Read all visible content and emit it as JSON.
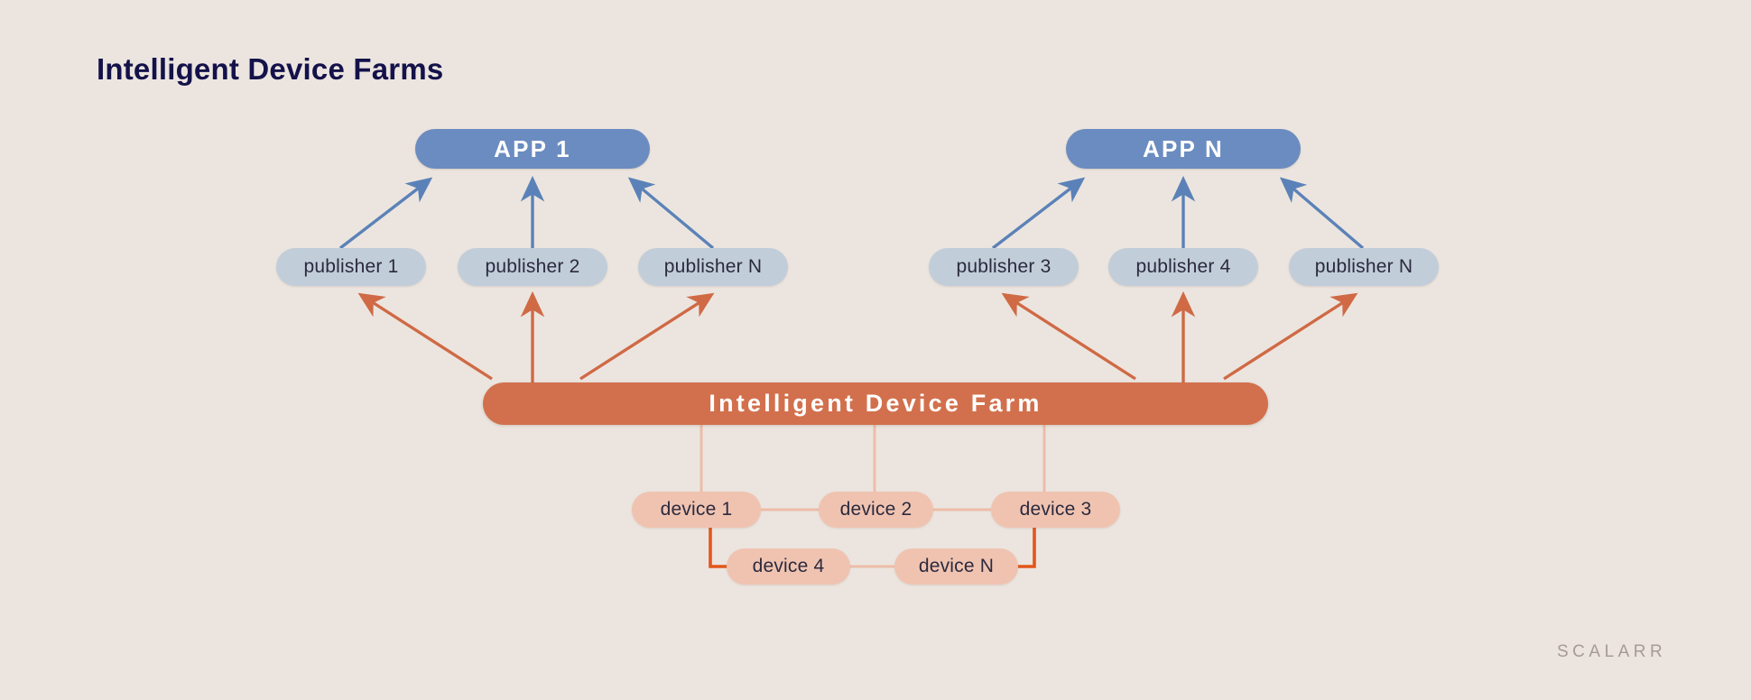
{
  "page": {
    "title": "Intelligent Device Farms",
    "watermark": "SCALARR",
    "background_color": "#ece5df",
    "title_color": "#14124a"
  },
  "colors": {
    "app_fill": "#6b8cc0",
    "app_text": "#ffffff",
    "publisher_fill": "#c2cdda",
    "publisher_text": "#2b2a3e",
    "farm_fill": "#d2704d",
    "farm_text": "#ffffff",
    "device_fill": "#f0c3b1",
    "device_text": "#2b2a3e",
    "blue_arrow": "#5b82b8",
    "orange_arrow": "#cf6a45",
    "light_link": "#edbda8",
    "bold_link": "#e2571b",
    "watermark_text": "#a79a96"
  },
  "diagram": {
    "apps": [
      {
        "id": "app-1",
        "label": "APP 1"
      },
      {
        "id": "app-n",
        "label": "APP N"
      }
    ],
    "publishers": [
      {
        "id": "publisher-1",
        "label": "publisher 1",
        "app": "app-1"
      },
      {
        "id": "publisher-2",
        "label": "publisher 2",
        "app": "app-1"
      },
      {
        "id": "publisher-n-left",
        "label": "publisher N",
        "app": "app-1"
      },
      {
        "id": "publisher-3",
        "label": "publisher 3",
        "app": "app-n"
      },
      {
        "id": "publisher-4",
        "label": "publisher 4",
        "app": "app-n"
      },
      {
        "id": "publisher-n-right",
        "label": "publisher N",
        "app": "app-n"
      }
    ],
    "farm": {
      "id": "intelligent-device-farm",
      "label": "Intelligent Device Farm"
    },
    "devices": [
      {
        "id": "device-1",
        "label": "device 1"
      },
      {
        "id": "device-2",
        "label": "device 2"
      },
      {
        "id": "device-3",
        "label": "device 3"
      },
      {
        "id": "device-4",
        "label": "device 4"
      },
      {
        "id": "device-n",
        "label": "device N"
      }
    ],
    "edges": {
      "publisher_to_app": [
        "publisher 1 → APP 1",
        "publisher 2 → APP 1",
        "publisher N → APP 1",
        "publisher 3 → APP N",
        "publisher 4 → APP N",
        "publisher N → APP N"
      ],
      "farm_to_publisher": [
        "Intelligent Device Farm → publisher 1",
        "Intelligent Device Farm → publisher 2",
        "Intelligent Device Farm → publisher N",
        "Intelligent Device Farm → publisher 3",
        "Intelligent Device Farm → publisher 4",
        "Intelligent Device Farm → publisher N"
      ],
      "farm_to_device": [
        "Intelligent Device Farm — device 1",
        "Intelligent Device Farm — device 2",
        "Intelligent Device Farm — device 3"
      ],
      "device_to_device": [
        "device 1 — device 2",
        "device 2 — device 3",
        "device 1 — device 4",
        "device 4 — device N",
        "device N — device 3"
      ]
    }
  }
}
